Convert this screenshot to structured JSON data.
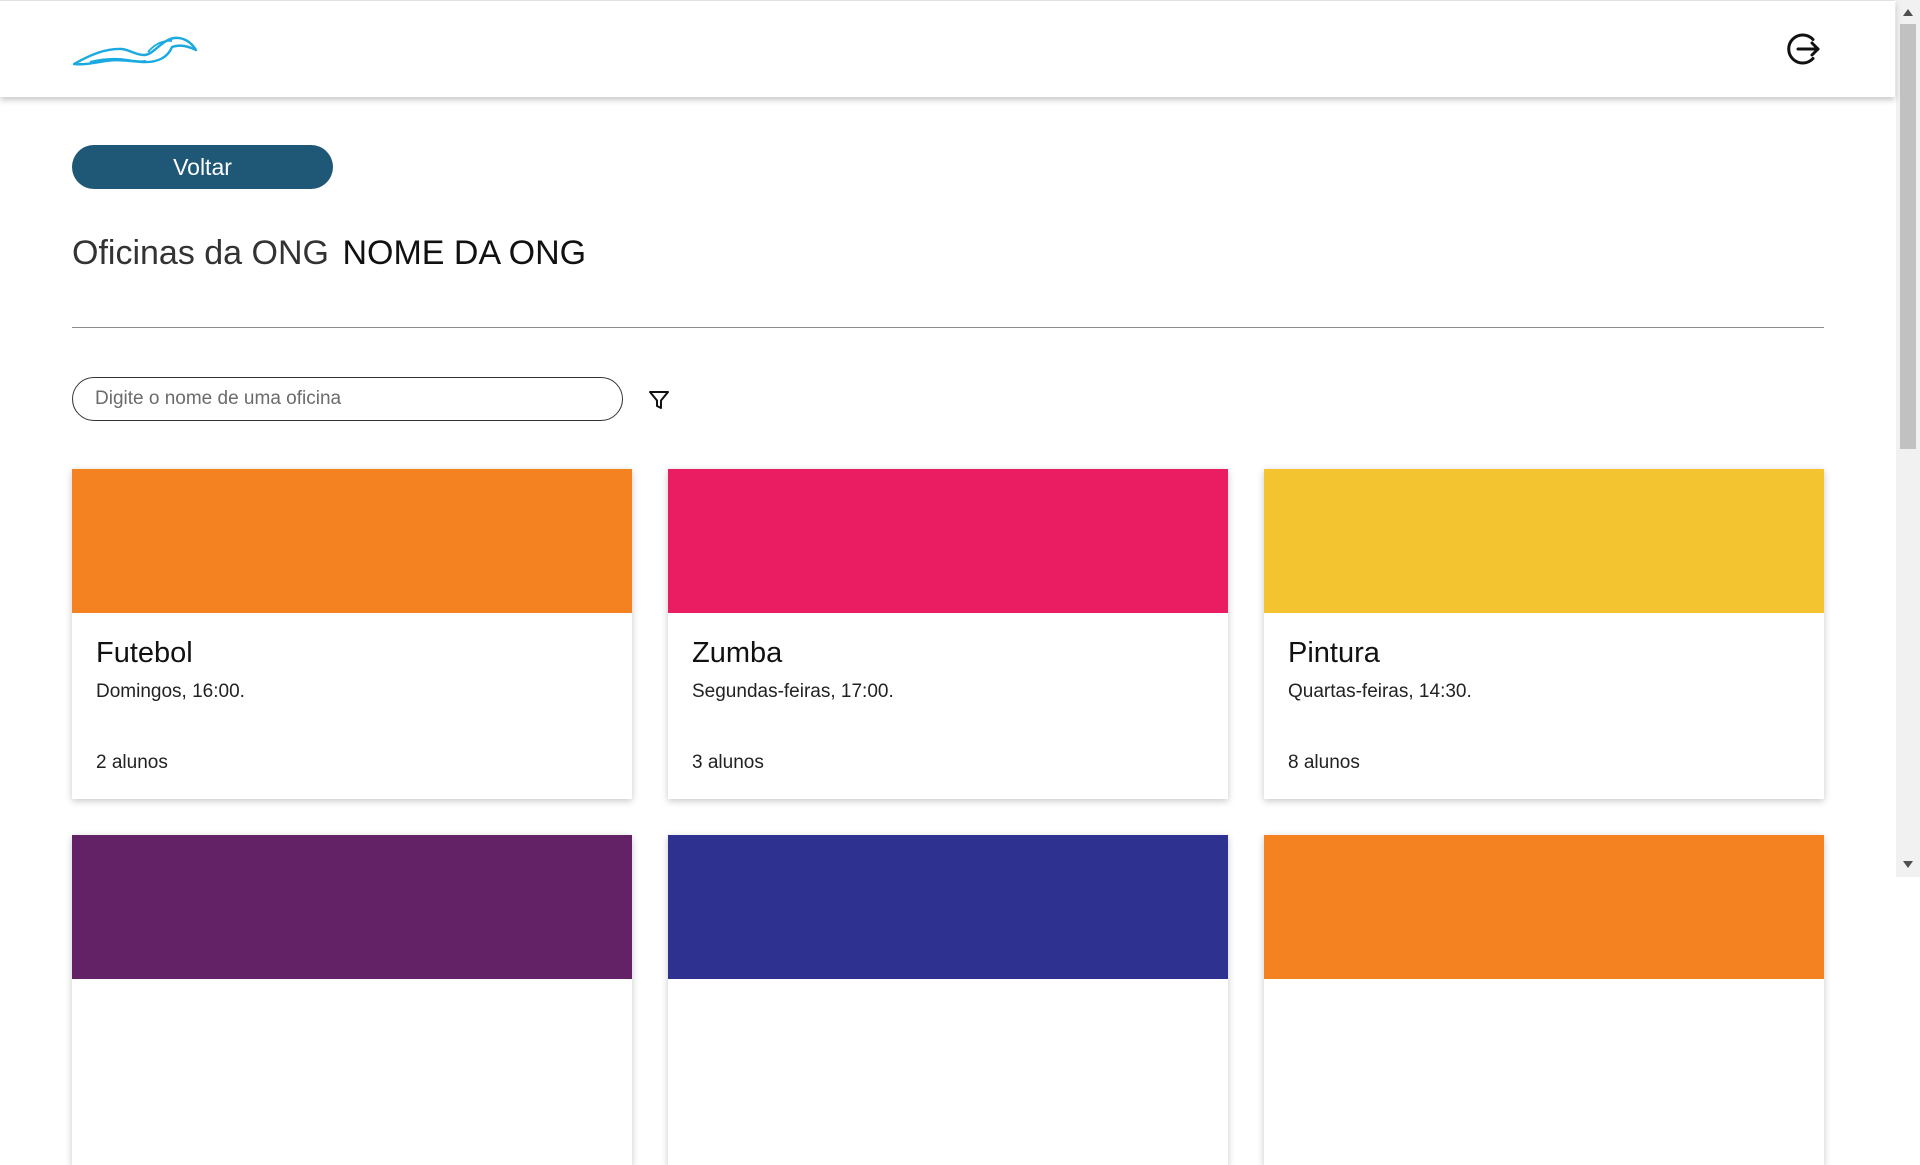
{
  "header": {
    "logo_icon": "bird-logo-icon",
    "logo_color": "#1aa9e0",
    "logout_icon": "logout-icon"
  },
  "back_button": {
    "label": "Voltar",
    "color": "#1f5776"
  },
  "title": {
    "prefix": "Oficinas da ONG",
    "org_name": "NOME DA ONG"
  },
  "search": {
    "placeholder": "Digite o nome de uma oficina",
    "value": ""
  },
  "filter_icon": "filter-icon",
  "workshops": [
    {
      "name": "Futebol",
      "schedule": "Domingos, 16:00.",
      "students": "2 alunos",
      "color": "#f58220"
    },
    {
      "name": "Zumba",
      "schedule": "Segundas-feiras, 17:00.",
      "students": "3 alunos",
      "color": "#ea1d63"
    },
    {
      "name": "Pintura",
      "schedule": "Quartas-feiras, 14:30.",
      "students": "8 alunos",
      "color": "#f4c430"
    },
    {
      "name": "",
      "schedule": "",
      "students": "",
      "color": "#632266"
    },
    {
      "name": "",
      "schedule": "",
      "students": "",
      "color": "#2e3190"
    },
    {
      "name": "",
      "schedule": "",
      "students": "",
      "color": "#f58220"
    }
  ]
}
